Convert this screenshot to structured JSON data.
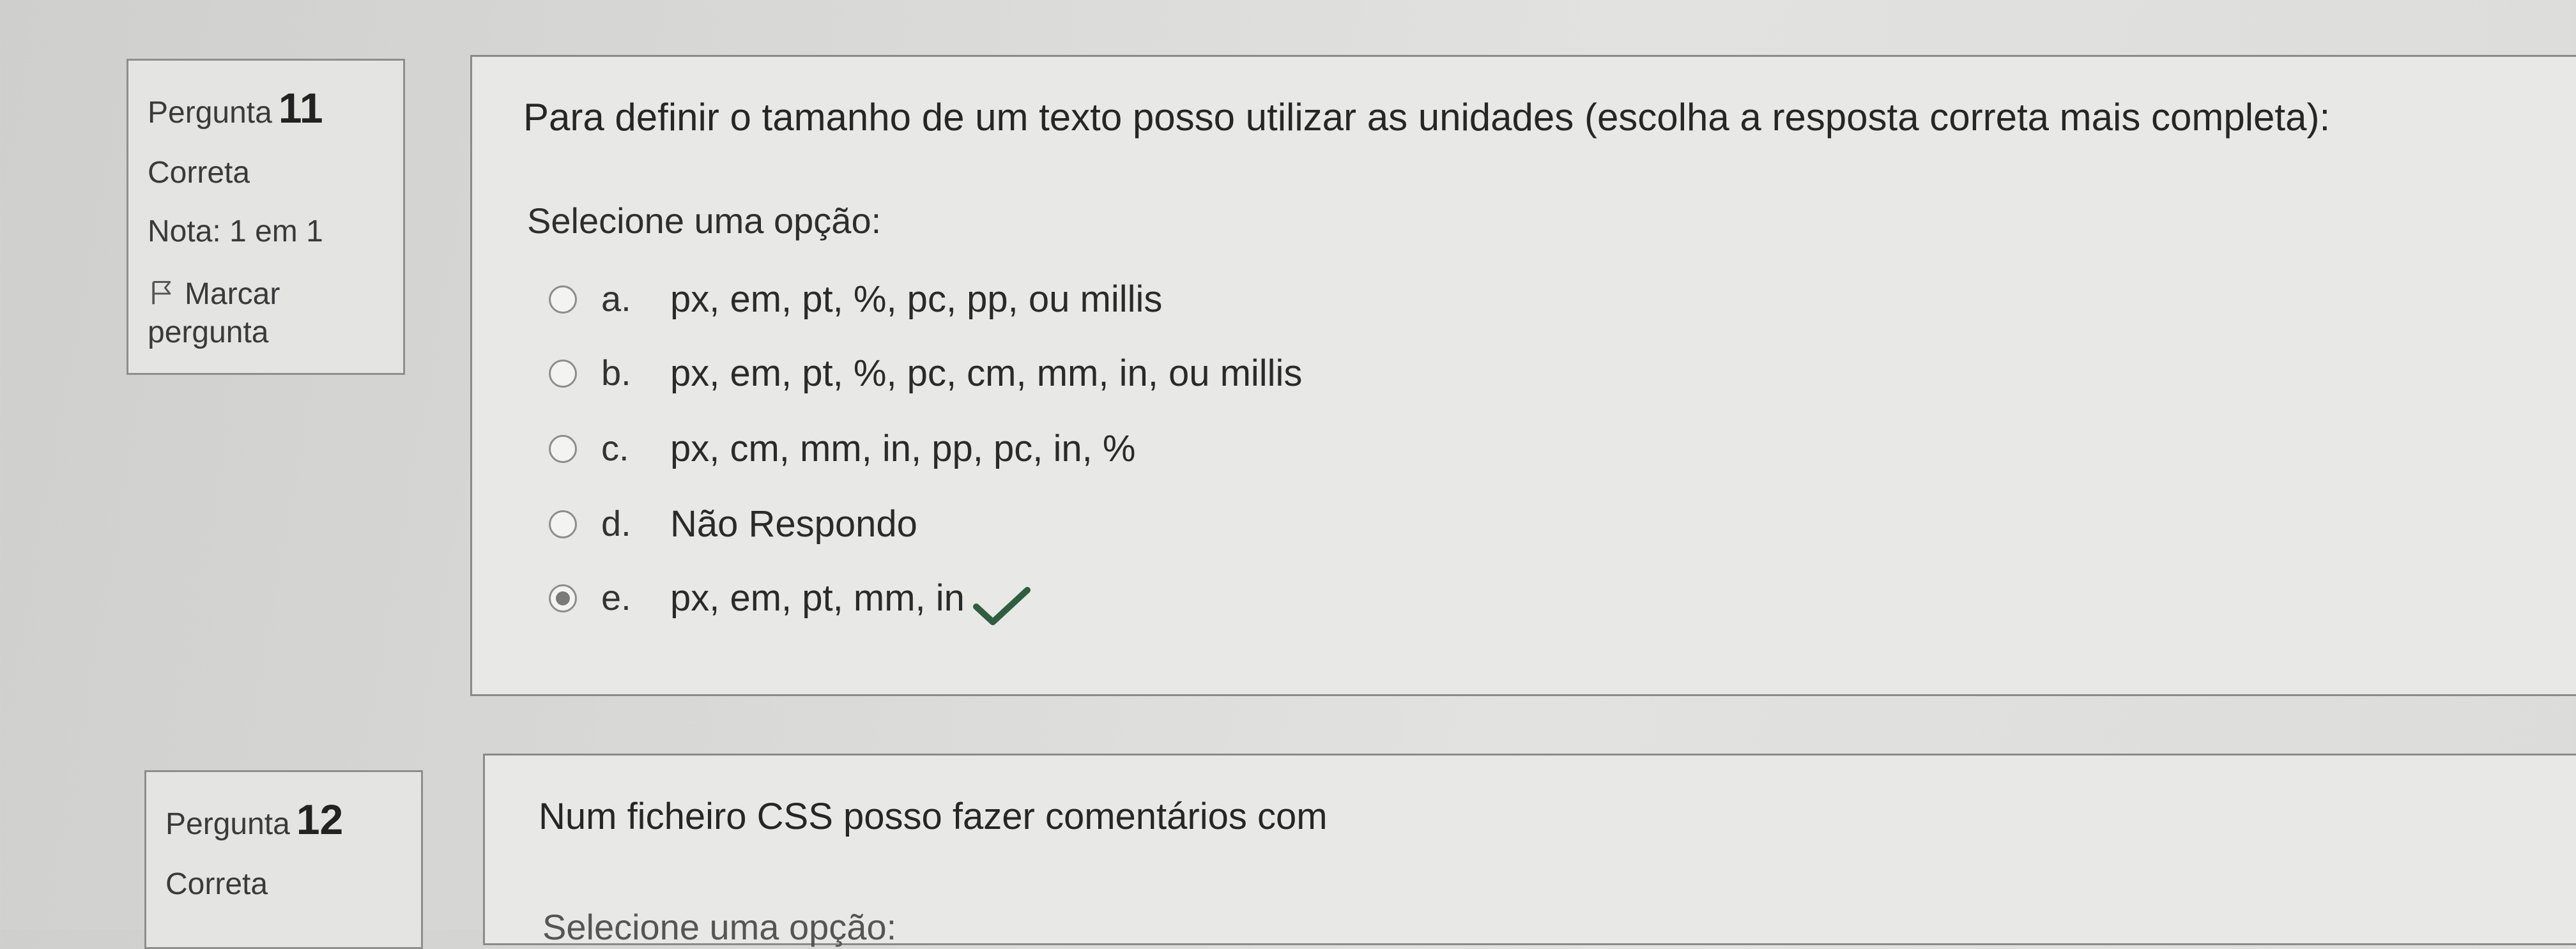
{
  "questions": [
    {
      "label": "Pergunta",
      "number": "11",
      "status": "Correta",
      "grade": "Nota: 1 em 1",
      "flag_label": "Marcar pergunta",
      "text": "Para definir o tamanho de um texto posso utilizar as unidades (escolha a resposta correta mais completa):",
      "prompt": "Selecione uma opção:",
      "selected_option": "e",
      "options": [
        {
          "letter": "a.",
          "text": "px, em, pt, %, pc, pp, ou millis"
        },
        {
          "letter": "b.",
          "text": "px, em, pt, %, pc, cm, mm, in, ou millis"
        },
        {
          "letter": "c.",
          "text": "px, cm, mm, in, pp, pc, in, %"
        },
        {
          "letter": "d.",
          "text": "Não Respondo"
        },
        {
          "letter": "e.",
          "text": "px, em, pt, mm, in",
          "correct": true
        }
      ]
    },
    {
      "label": "Pergunta",
      "number": "12",
      "status": "Correta",
      "text": "Num ficheiro CSS posso fazer comentários com",
      "prompt": "Selecione uma opção:"
    }
  ],
  "icons": {
    "flag": "flag-outline-icon",
    "correct": "checkmark-icon"
  },
  "colors": {
    "correct_check": "#2f5d3f"
  }
}
